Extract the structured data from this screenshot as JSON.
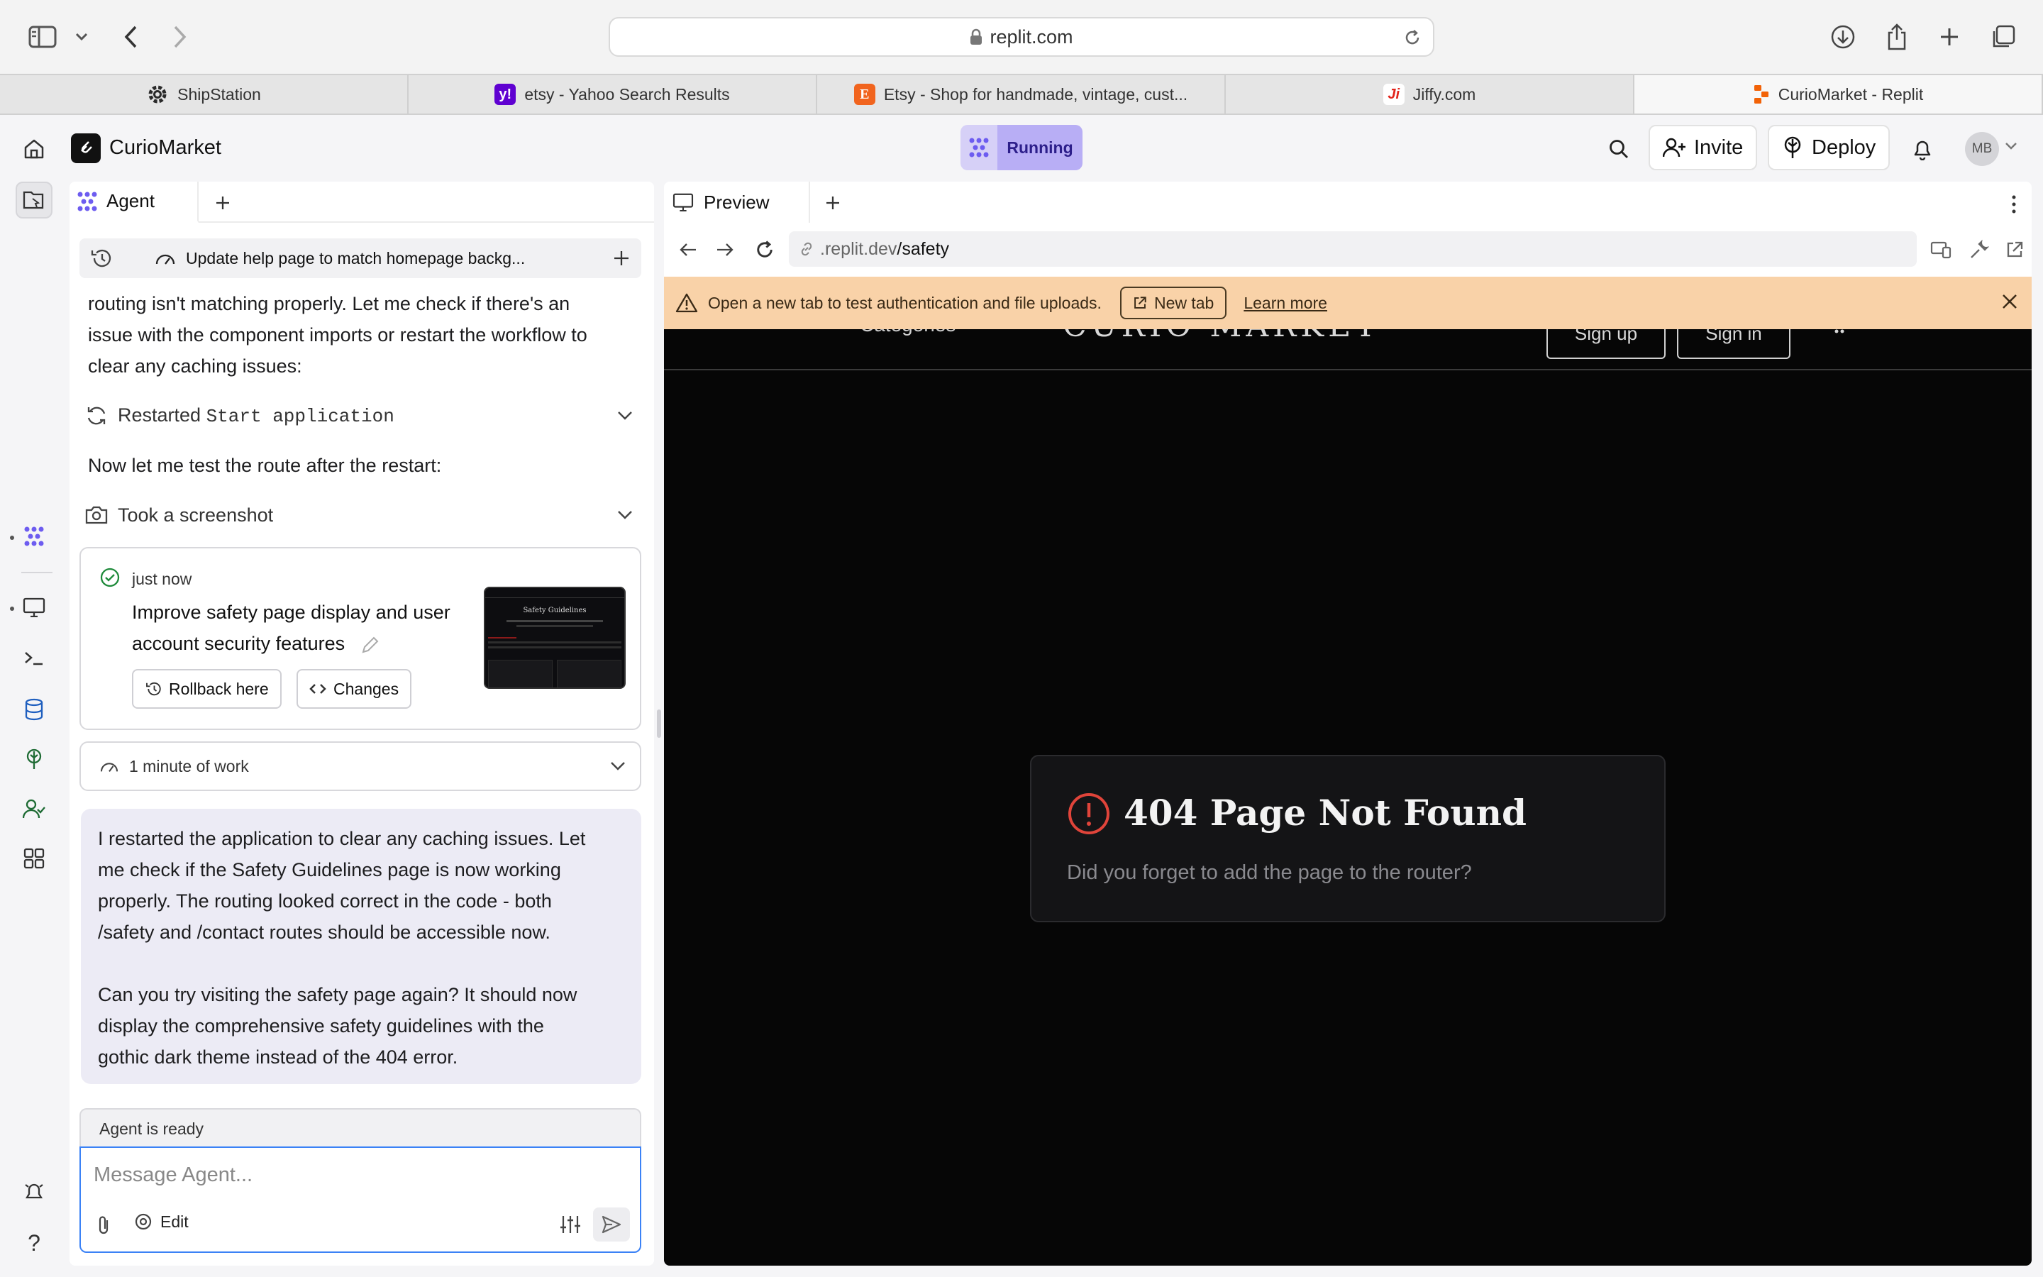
{
  "browser": {
    "url": "replit.com",
    "tabs": [
      {
        "title": "ShipStation",
        "icon": "shipstation-gear-icon",
        "color": "#1f1f1f"
      },
      {
        "title": "etsy - Yahoo Search Results",
        "icon": "yahoo-icon",
        "color": "#5f01d1"
      },
      {
        "title": "Etsy - Shop for handmade, vintage, cust...",
        "icon": "etsy-icon",
        "color": "#f1641e"
      },
      {
        "title": "Jiffy.com",
        "icon": "jiffy-icon",
        "color": "#e2231a"
      },
      {
        "title": "CurioMarket - Replit",
        "icon": "replit-icon",
        "color": "#f26207"
      }
    ]
  },
  "header": {
    "project_name": "CurioMarket",
    "run_status": "Running",
    "invite_label": "Invite",
    "deploy_label": "Deploy",
    "avatar_initials": "MB"
  },
  "agent": {
    "tab_label": "Agent",
    "task_title": "Update help page to match homepage backg...",
    "messages": {
      "intro_lines": [
        "routing isn't matching properly. Let me check if there's an",
        "issue with the component imports or restart the workflow to",
        "clear any caching issues:"
      ],
      "restart_prefix": "Restarted",
      "restart_code": "Start application",
      "test_text": "Now let me test the route after the restart:",
      "screenshot_label": "Took a screenshot"
    },
    "checkpoint": {
      "time": "just now",
      "title_lines": [
        "Improve safety page display and user",
        "account security features"
      ],
      "rollback_label": "Rollback here",
      "changes_label": "Changes",
      "thumbnail_title": "Safety Guidelines"
    },
    "work_label": "1 minute of work",
    "response": {
      "para1_lines": [
        "I restarted the application to clear any caching issues. Let",
        "me check if the Safety Guidelines page is now working",
        "properly. The routing looked correct in the code - both",
        "/safety and /contact routes should be accessible now."
      ],
      "para2_lines": [
        "Can you try visiting the safety page again? It should now",
        "display the comprehensive safety guidelines with the",
        "gothic dark theme instead of the 404 error."
      ]
    },
    "status": "Agent is ready",
    "input_placeholder": "Message Agent...",
    "edit_label": "Edit"
  },
  "preview": {
    "tab_label": "Preview",
    "url_prefix": ".replit.dev",
    "url_path": "/safety",
    "banner": {
      "text": "Open a new tab to test authentication and file uploads.",
      "new_tab_label": "New tab",
      "learn_more_label": "Learn more"
    },
    "site": {
      "nav_categories": "Categories",
      "nav_logo": "CURIO MARKET",
      "nav_signup": "Sign up",
      "nav_signin": "Sign in",
      "error_title": "404 Page Not Found",
      "error_subtitle": "Did you forget to add the page to the router?"
    }
  }
}
